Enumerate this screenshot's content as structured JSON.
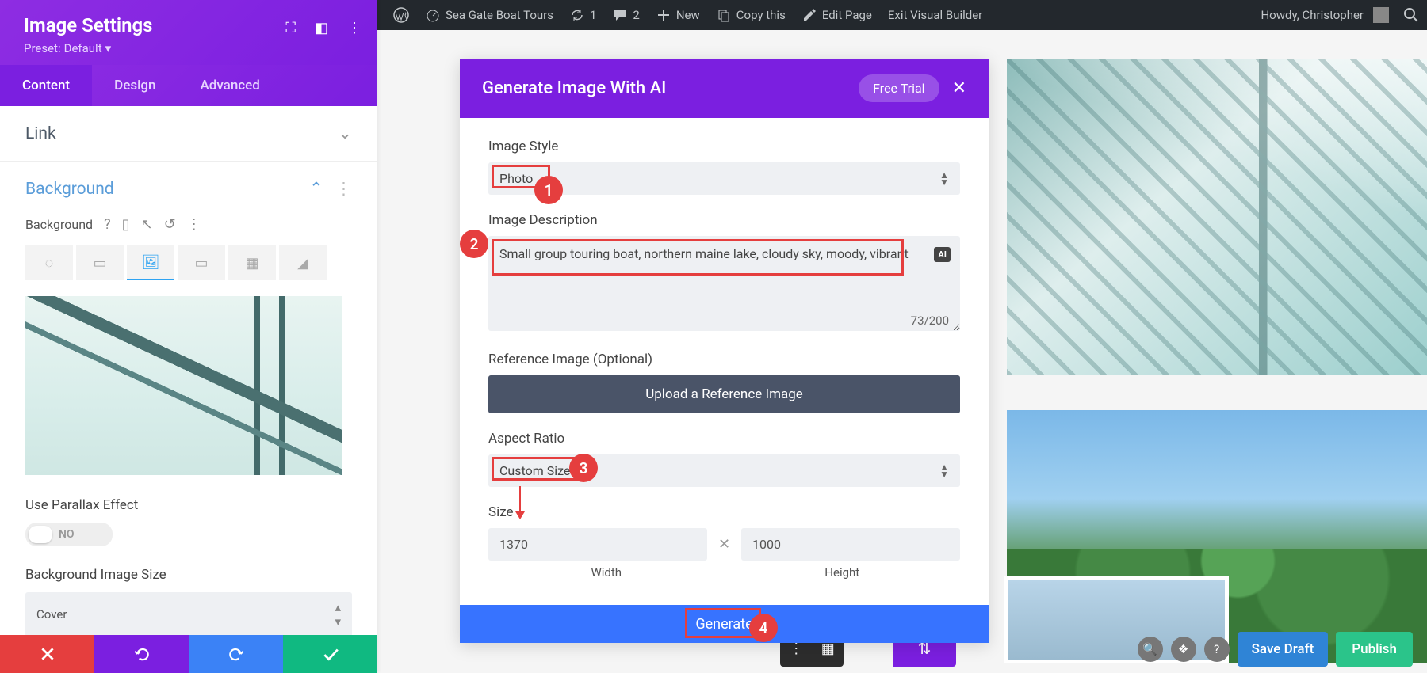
{
  "admin_bar": {
    "site_name": "Sea Gate Boat Tours",
    "updates": "1",
    "comments": "2",
    "new": "New",
    "copy": "Copy this",
    "edit": "Edit Page",
    "exit": "Exit Visual Builder",
    "greeting": "Howdy, Christopher"
  },
  "panel": {
    "title": "Image Settings",
    "preset_label": "Preset:",
    "preset_value": "Default",
    "tabs": {
      "content": "Content",
      "design": "Design",
      "advanced": "Advanced"
    },
    "sections": {
      "link": "Link",
      "background": "Background"
    },
    "bg_label": "Background",
    "parallax_label": "Use Parallax Effect",
    "parallax_value": "NO",
    "bg_size_label": "Background Image Size",
    "bg_size_value": "Cover"
  },
  "ai_modal": {
    "title": "Generate Image With AI",
    "trial": "Free Trial",
    "style_label": "Image Style",
    "style_value": "Photo",
    "desc_label": "Image Description",
    "desc_value": "Small group touring boat, northern maine lake, cloudy sky, moody, vibrant",
    "desc_count": "73/200",
    "ai_chip": "AI",
    "ref_label": "Reference Image (Optional)",
    "upload_btn": "Upload a Reference Image",
    "aspect_label": "Aspect Ratio",
    "aspect_value": "Custom Size",
    "size_label": "Size",
    "width_value": "1370",
    "height_value": "1000",
    "width_label": "Width",
    "height_label": "Height",
    "generate_btn": "Generate"
  },
  "publish": {
    "save_draft": "Save Draft",
    "publish": "Publish"
  },
  "annotations": {
    "a1": "1",
    "a2": "2",
    "a3": "3",
    "a4": "4"
  }
}
